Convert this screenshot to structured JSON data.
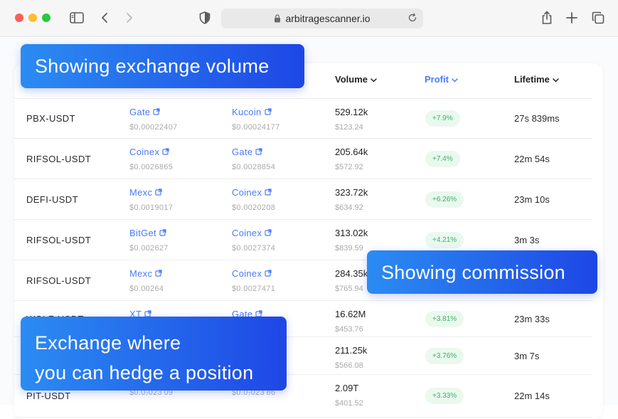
{
  "browser": {
    "url": "arbitragescanner.io"
  },
  "table": {
    "headers": {
      "volume": "Volume",
      "profit": "Profit",
      "lifetime": "Lifetime"
    },
    "rows": [
      {
        "pair": "PBX-USDT",
        "buy_exchange": "Gate",
        "buy_price": "$0.00022407",
        "sell_exchange": "Kucoin",
        "sell_price": "$0.00024177",
        "volume": "529.12k",
        "volume_usd": "$123.24",
        "profit": "+7.9%",
        "lifetime": "27s 839ms"
      },
      {
        "pair": "RIFSOL-USDT",
        "buy_exchange": "Coinex",
        "buy_price": "$0.0026865",
        "sell_exchange": "Gate",
        "sell_price": "$0.0028854",
        "volume": "205.64k",
        "volume_usd": "$572.92",
        "profit": "+7.4%",
        "lifetime": "22m 54s"
      },
      {
        "pair": "DEFI-USDT",
        "buy_exchange": "Mexc",
        "buy_price": "$0.0019017",
        "sell_exchange": "Coinex",
        "sell_price": "$0.0020208",
        "volume": "323.72k",
        "volume_usd": "$634.92",
        "profit": "+6.26%",
        "lifetime": "23m 10s"
      },
      {
        "pair": "RIFSOL-USDT",
        "buy_exchange": "BitGet",
        "buy_price": "$0.002627",
        "sell_exchange": "Coinex",
        "sell_price": "$0.0027374",
        "volume": "313.02k",
        "volume_usd": "$839.59",
        "profit": "+4.21%",
        "lifetime": "3m 3s"
      },
      {
        "pair": "RIFSOL-USDT",
        "buy_exchange": "Mexc",
        "buy_price": "$0.00264",
        "sell_exchange": "Coinex",
        "sell_price": "$0.0027471",
        "volume": "284.35k",
        "volume_usd": "$765.94",
        "profit": "",
        "lifetime": ""
      },
      {
        "pair": "WOLF-USDT",
        "buy_exchange": "XT",
        "buy_price": "",
        "sell_exchange": "Gate",
        "sell_price": "",
        "volume": "16.62M",
        "volume_usd": "$453.76",
        "profit": "+3.81%",
        "lifetime": "23m 33s"
      },
      {
        "pair": "",
        "buy_exchange": "",
        "buy_price": "",
        "sell_exchange": "",
        "sell_price": "",
        "volume": "211.25k",
        "volume_usd": "$566.08",
        "profit": "+3.76%",
        "lifetime": "3m 7s"
      },
      {
        "pair": "PIT-USDT",
        "buy_exchange": "",
        "buy_price": "$0.0₇023 09",
        "sell_exchange": "",
        "sell_price": "$0.0₇023 86",
        "volume": "2.09T",
        "volume_usd": "$401.52",
        "profit": "+3.33%",
        "lifetime": "22m 14s"
      }
    ]
  },
  "callouts": {
    "volume": "Showing exchange volume",
    "commission": "Showing commission",
    "hedge_line1": "Exchange where",
    "hedge_line2": "you can hedge a position"
  },
  "icons": {
    "sidebar": "sidebar-icon",
    "back": "chevron-left-icon",
    "forward": "chevron-right-icon",
    "privacy": "shield-icon",
    "lock": "lock-icon",
    "reload": "reload-icon",
    "share": "share-icon",
    "new_tab": "plus-icon",
    "tabs": "tabs-icon",
    "external": "external-link-icon",
    "sort": "chevron-down-icon"
  },
  "colors": {
    "accent": "#4a7bf7",
    "profit_text": "#3ab26a",
    "profit_bg": "#eaf8ee",
    "callout_start": "#2b8cf2",
    "callout_end": "#1e47e6"
  }
}
